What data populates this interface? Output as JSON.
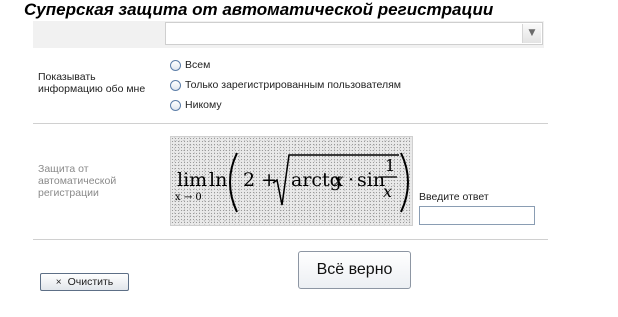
{
  "page": {
    "title": "Суперская защита от автоматической регистрации"
  },
  "privacy": {
    "label_line1": "Показывать",
    "label_line2": "информацию обо мне",
    "options": [
      {
        "label": "Всем"
      },
      {
        "label": "Только зарегистрированным пользователям"
      },
      {
        "label": "Никому"
      }
    ]
  },
  "captcha": {
    "label_line1": "Защита от",
    "label_line2": "автоматической",
    "label_line3": "регистрации",
    "formula": {
      "lim": "lim",
      "lim_sub": "x → 0",
      "ln": "ln",
      "two_plus": "2 +",
      "arctg": "arctg",
      "var": "x",
      "dot": "·",
      "sin": "sin",
      "numerator": "1",
      "denominator": "x"
    },
    "answer_label": "Введите ответ",
    "answer_value": ""
  },
  "buttons": {
    "clear_icon": "×",
    "clear_label": "Очистить",
    "submit_label": "Всё верно"
  },
  "colors": {
    "button_border": "#5d6f86",
    "radio_border": "#5d7ea8"
  }
}
